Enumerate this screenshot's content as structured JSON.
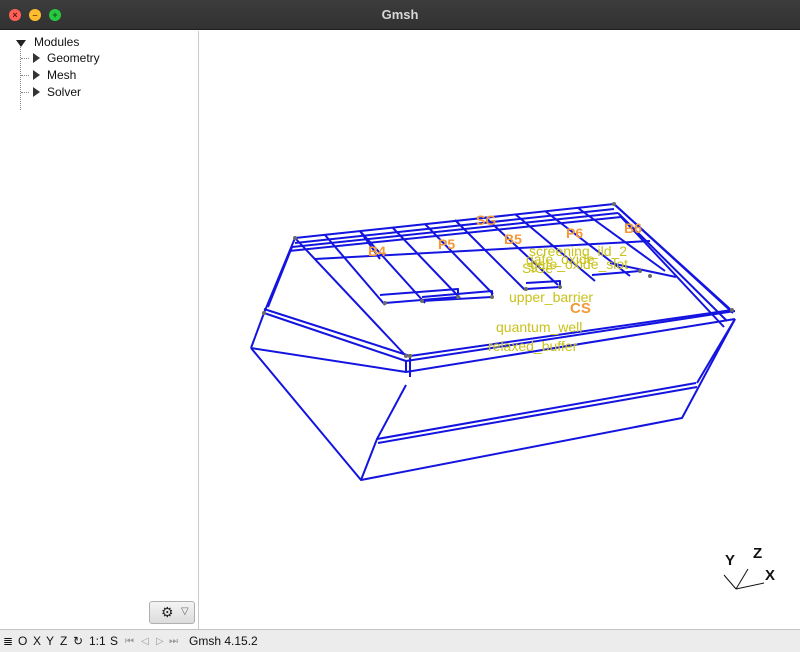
{
  "window": {
    "title": "Gmsh"
  },
  "tree": {
    "root": "Modules",
    "items": [
      "Geometry",
      "Mesh",
      "Solver"
    ]
  },
  "options_button": {
    "icon": "gear-icon",
    "dropdown": "▽"
  },
  "viewport": {
    "labels_orange": [
      "B4",
      "P5",
      "SG",
      "B5",
      "P6",
      "B6",
      "CS"
    ],
    "labels_yellow": [
      "screening_ild_2",
      "gate_oxide",
      "gate_oxide_slot",
      "SiGe",
      "upper_barrier",
      "quantum_well",
      "relaxed_buffer"
    ],
    "axes": {
      "x": "X",
      "y": "Y",
      "z": "Z"
    },
    "colors": {
      "wireframe": "#1414e0",
      "label_orange": "#f39a3a",
      "label_yellow": "#c9c21a",
      "point": "#6b6b6b"
    }
  },
  "statusbar": {
    "menu_icon": "≣",
    "o_label": "O",
    "x_label": "X",
    "y_label": "Y",
    "z_label": "Z",
    "rotate_icon": "↻",
    "scale_label": "1:1",
    "s_label": "S",
    "first_icon": "⏮",
    "prev_icon": "◁",
    "play_icon": "▷",
    "last_icon": "⏭",
    "version": "Gmsh 4.15.2"
  }
}
